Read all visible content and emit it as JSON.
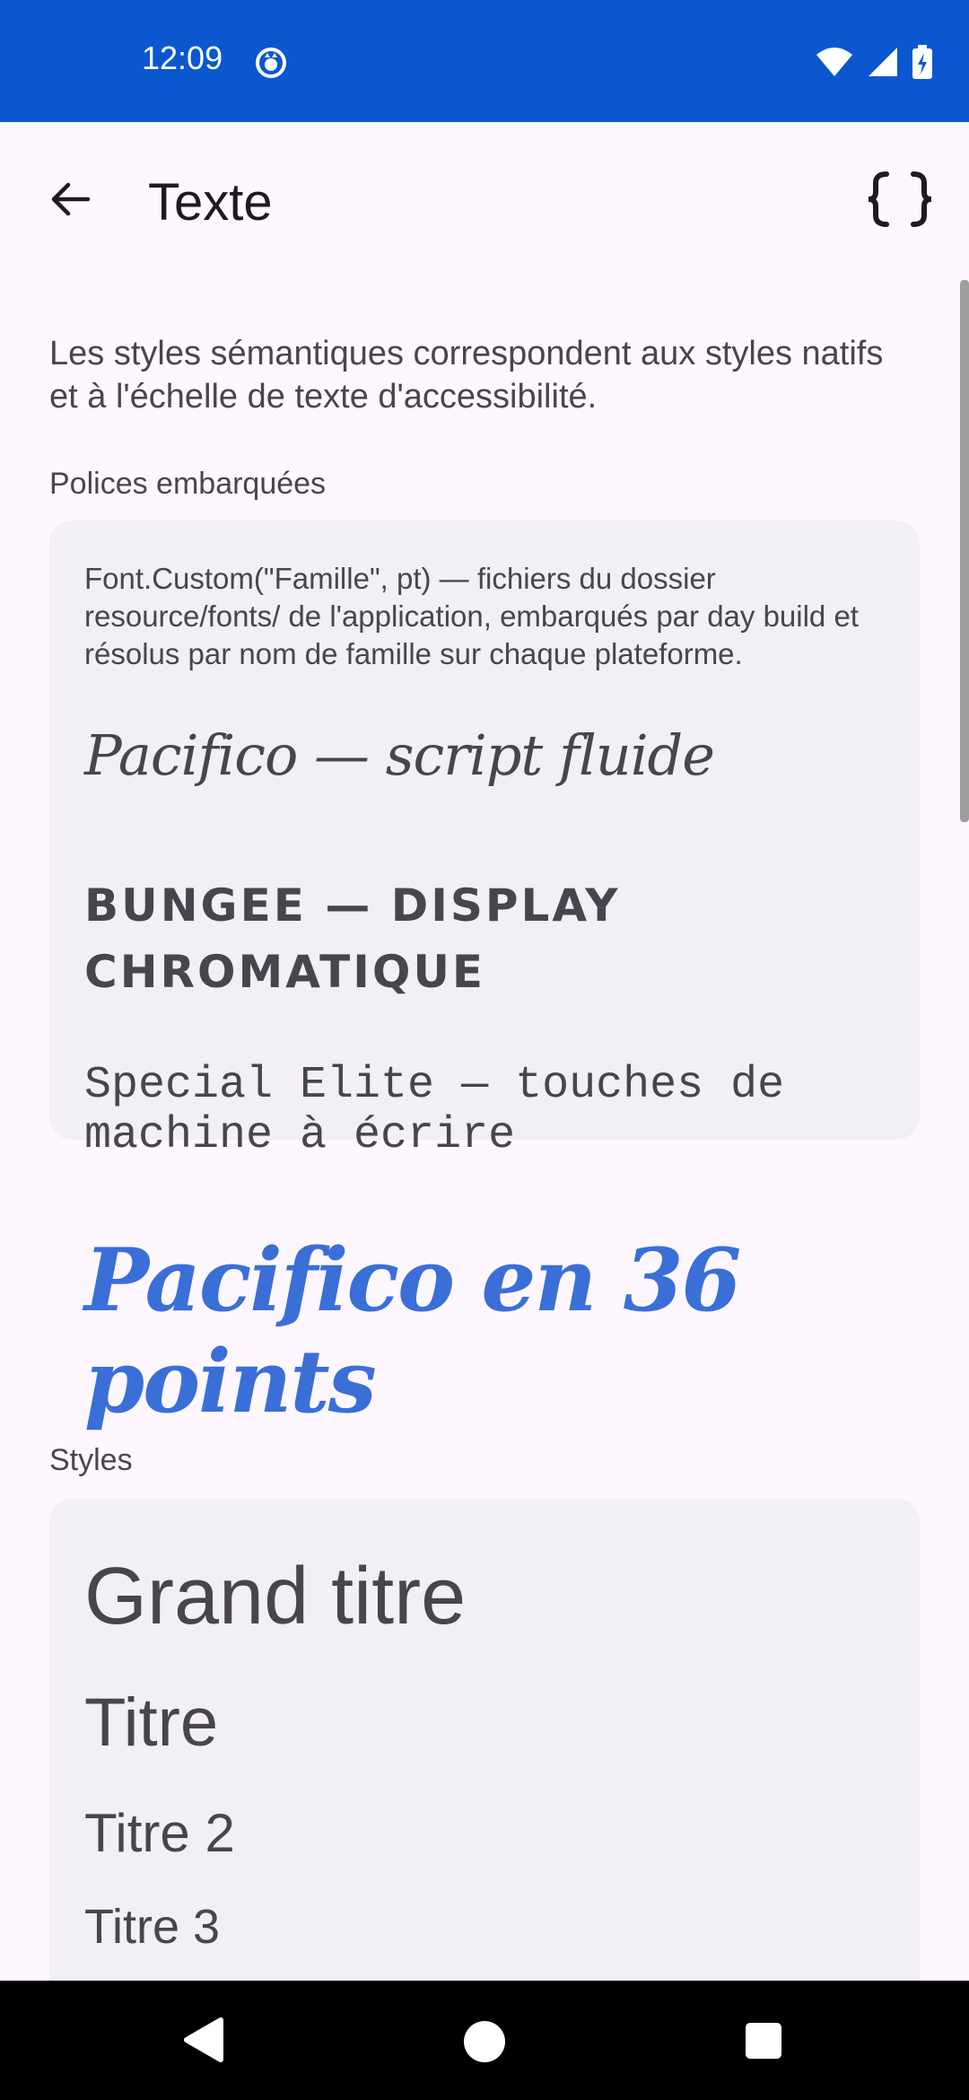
{
  "status_bar": {
    "time": "12:09",
    "icons": [
      "notification-icon",
      "wifi-icon",
      "signal-icon",
      "battery-charging-icon"
    ]
  },
  "app_bar": {
    "title": "Texte",
    "back_icon": "arrow-back-icon",
    "code_icon": "curly-braces-icon"
  },
  "intro": "Les styles sémantiques correspondent aux styles natifs et à l'échelle de texte d'accessibilité.",
  "embedded_fonts": {
    "label": "Polices embarquées",
    "description": "Font.Custom(\"Famille\", pt) — fichiers du dossier resource/fonts/ de l'application, embarqués par day build et résolus par nom de famille sur chaque plateforme.",
    "samples": {
      "pacifico": "Pacifico — script fluide",
      "bungee": "Bungee — display chromatique",
      "special_elite": "Special Elite — touches de machine à écrire",
      "pacifico_36": "Pacifico en 36 points"
    },
    "accent_color": "#3A6FD8"
  },
  "styles": {
    "label": "Styles",
    "items": [
      "Grand titre",
      "Titre",
      "Titre 2",
      "Titre 3"
    ]
  },
  "colors": {
    "status_bar": "#0B57D0",
    "background": "#FEF7FF",
    "card": "#F2EFF5",
    "text": "#49454F"
  }
}
